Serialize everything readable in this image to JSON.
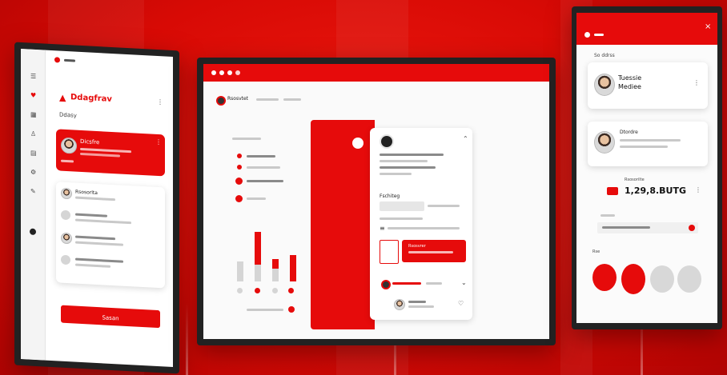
{
  "colors": {
    "accent": "#e60b0b",
    "background": "#d80a05",
    "surface": "#ffffff"
  },
  "left_panel": {
    "title": "Ddagfrav",
    "subtitle": "Ddasy",
    "featured_card_name": "Dicsfre",
    "list_items": [
      {
        "name": "Rsosorlta",
        "icon": "avatar-icon"
      },
      {
        "name": "",
        "icon": "user-icon"
      },
      {
        "name": "",
        "icon": "avatar-icon"
      },
      {
        "name": "",
        "icon": "user-icon"
      }
    ],
    "sidebar_icons": [
      "menu-icon",
      "heart-icon",
      "grid-icon",
      "user-icon",
      "chart-icon",
      "settings-icon",
      "edit-icon",
      "circle-icon"
    ],
    "primary_button": "Sasan"
  },
  "center_panel": {
    "header_title": "Rsosvtet",
    "chart_bars": [
      {
        "grey": 0.6,
        "red": 0.0
      },
      {
        "grey": 0.5,
        "red": 1.0
      },
      {
        "grey": 0.4,
        "red": 0.3
      },
      {
        "grey": 0.0,
        "red": 0.8
      }
    ],
    "section_label": "Fschiteg",
    "action_label": "Rsosvrer"
  },
  "right_panel": {
    "label": "So ddrss",
    "profile_name": "Tuessie Mediee",
    "second_profile": "Dtordre",
    "amount_label": "Rsosorilte",
    "amount": "1,29,8.BUTG",
    "section_label": "Rse"
  }
}
